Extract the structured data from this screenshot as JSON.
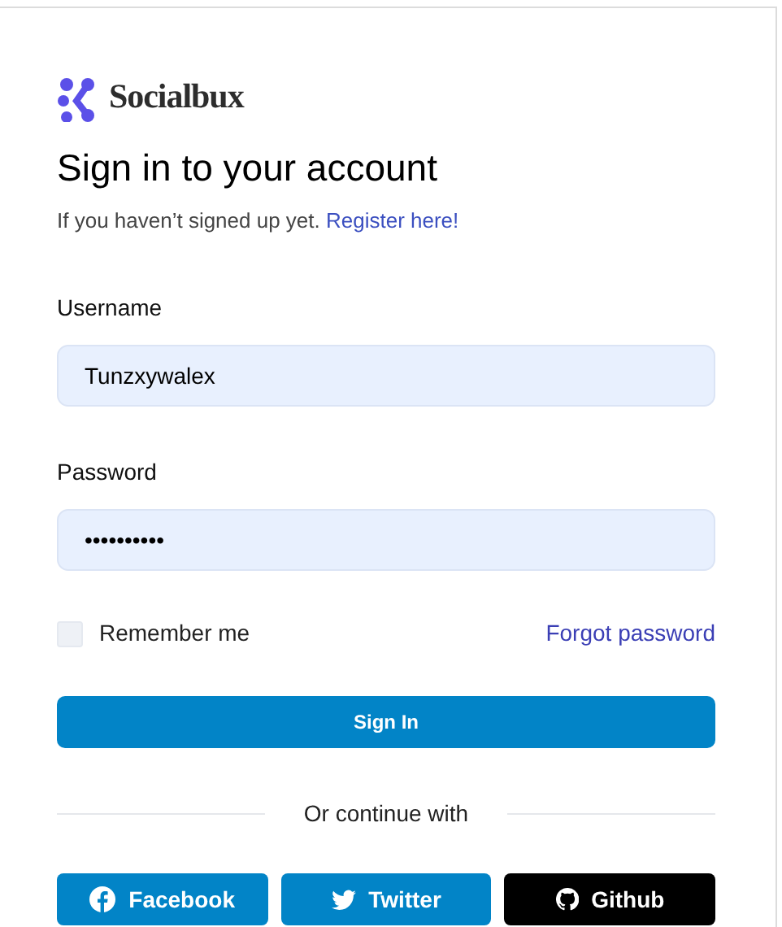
{
  "brand": {
    "name": "Socialbux"
  },
  "title": "Sign in to your account",
  "subtitle": {
    "text": "If you haven’t signed up yet.",
    "link": "Register here!"
  },
  "fields": [
    {
      "label": "Username",
      "value": "Tunzxywalex"
    },
    {
      "label": "Password",
      "value": "••••••••••"
    }
  ],
  "remember": {
    "label": "Remember me",
    "checked": false
  },
  "forgot_link": "Forgot password",
  "submit": "Sign In",
  "divider": "Or continue with",
  "socials": [
    {
      "kind": "facebook",
      "label": "Facebook"
    },
    {
      "kind": "twitter",
      "label": "Twitter"
    },
    {
      "kind": "github",
      "label": "Github"
    }
  ]
}
